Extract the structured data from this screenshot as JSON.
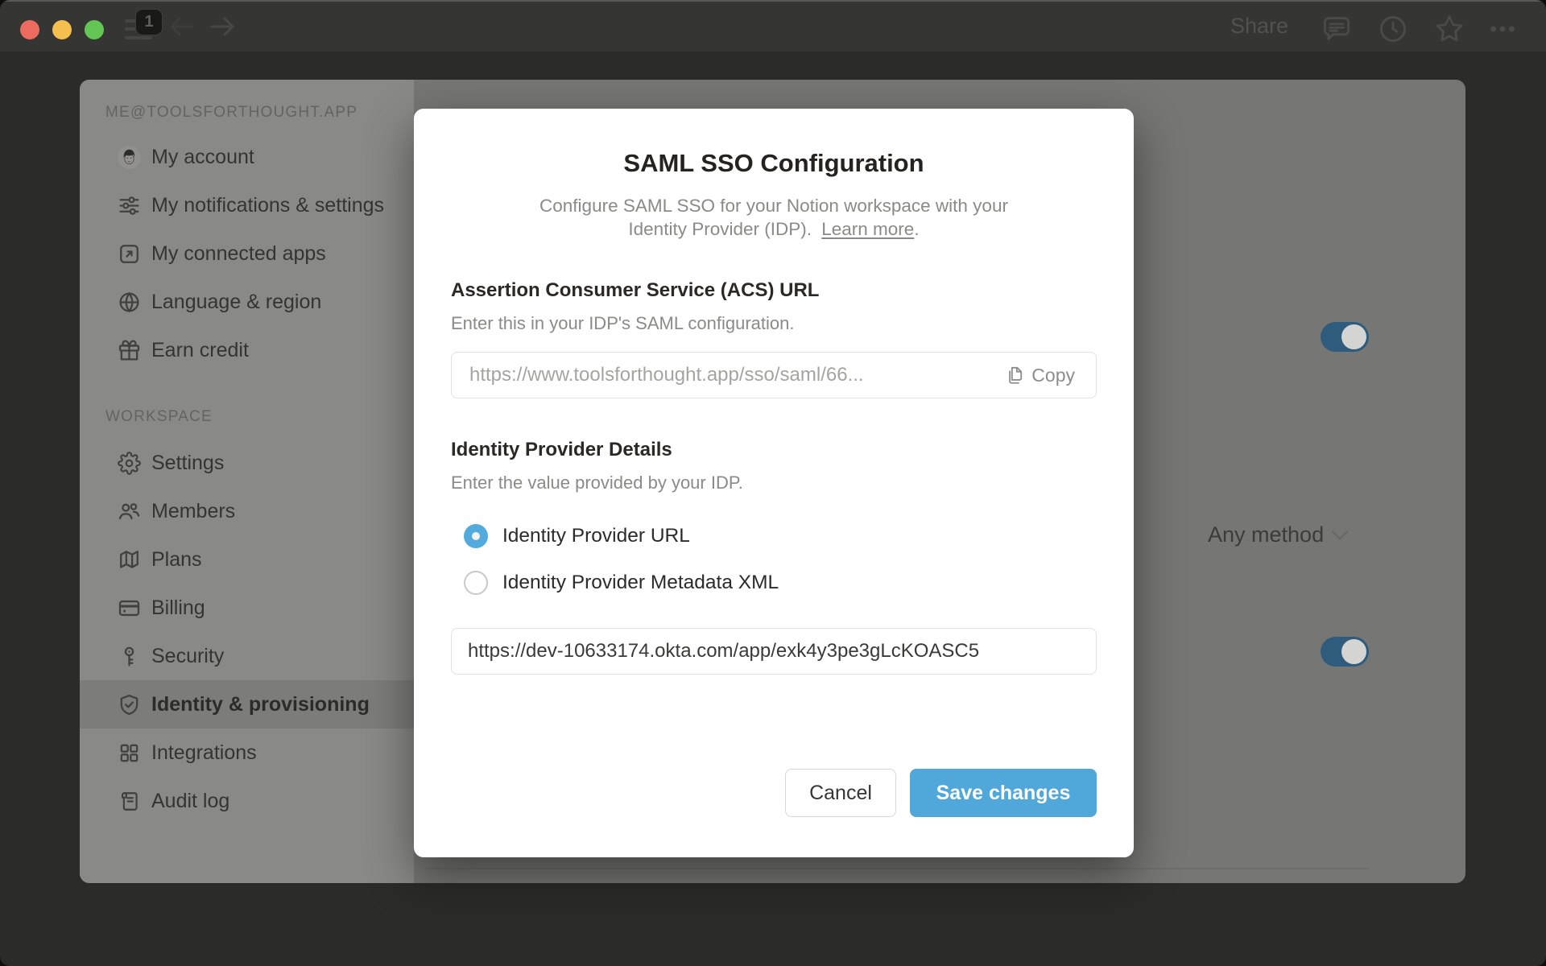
{
  "titlebar": {
    "share_label": "Share",
    "sidebar_badge": "1"
  },
  "sidebar": {
    "account_section_label": "ME@TOOLSFORTHOUGHT.APP",
    "account_items": [
      {
        "label": "My account",
        "icon": "avatar"
      },
      {
        "label": "My notifications & settings",
        "icon": "sliders-icon"
      },
      {
        "label": "My connected apps",
        "icon": "arrow-up-right-icon"
      },
      {
        "label": "Language & region",
        "icon": "globe-icon"
      },
      {
        "label": "Earn credit",
        "icon": "gift-icon"
      }
    ],
    "workspace_section_label": "WORKSPACE",
    "workspace_items": [
      {
        "label": "Settings",
        "icon": "gear-icon",
        "selected": false
      },
      {
        "label": "Members",
        "icon": "users-icon",
        "selected": false
      },
      {
        "label": "Plans",
        "icon": "map-icon",
        "selected": false
      },
      {
        "label": "Billing",
        "icon": "credit-card-icon",
        "selected": false
      },
      {
        "label": "Security",
        "icon": "key-icon",
        "selected": false
      },
      {
        "label": "Identity & provisioning",
        "icon": "shield-check-icon",
        "selected": true
      },
      {
        "label": "Integrations",
        "icon": "grid-icon",
        "selected": false
      },
      {
        "label": "Audit log",
        "icon": "scroll-icon",
        "selected": false
      }
    ]
  },
  "background_content": {
    "dropdown_value": "Any method",
    "toggle_top_state": "on",
    "toggle_bottom_state": "on"
  },
  "modal": {
    "title": "SAML SSO Configuration",
    "subtitle_line1": "Configure SAML SSO for your Notion workspace with your",
    "subtitle_line2": "Identity Provider (IDP).",
    "learn_more": "Learn more",
    "learn_more_suffix": ".",
    "acs": {
      "heading": "Assertion Consumer Service (ACS) URL",
      "description": "Enter this in your IDP's SAML configuration.",
      "value": "https://www.toolsforthought.app/sso/saml/66...",
      "copy_label": "Copy"
    },
    "idp": {
      "heading": "Identity Provider Details",
      "description": "Enter the value provided by your IDP.",
      "radio_url_label": "Identity Provider URL",
      "radio_xml_label": "Identity Provider Metadata XML",
      "selected_radio": "Identity Provider URL",
      "value": "https://dev-10633174.okta.com/app/exk4y3pe3gLcKOASC5"
    },
    "cancel_label": "Cancel",
    "save_label": "Save changes"
  },
  "colors": {
    "accent_blue": "#4fa7da",
    "radio_blue": "#53aadd",
    "toggle_dimmed_blue": "#2f5c7c",
    "modal_bg": "#ffffff",
    "sidebar_bg_dimmed": "#898987",
    "content_bg_dimmed": "#767674"
  }
}
